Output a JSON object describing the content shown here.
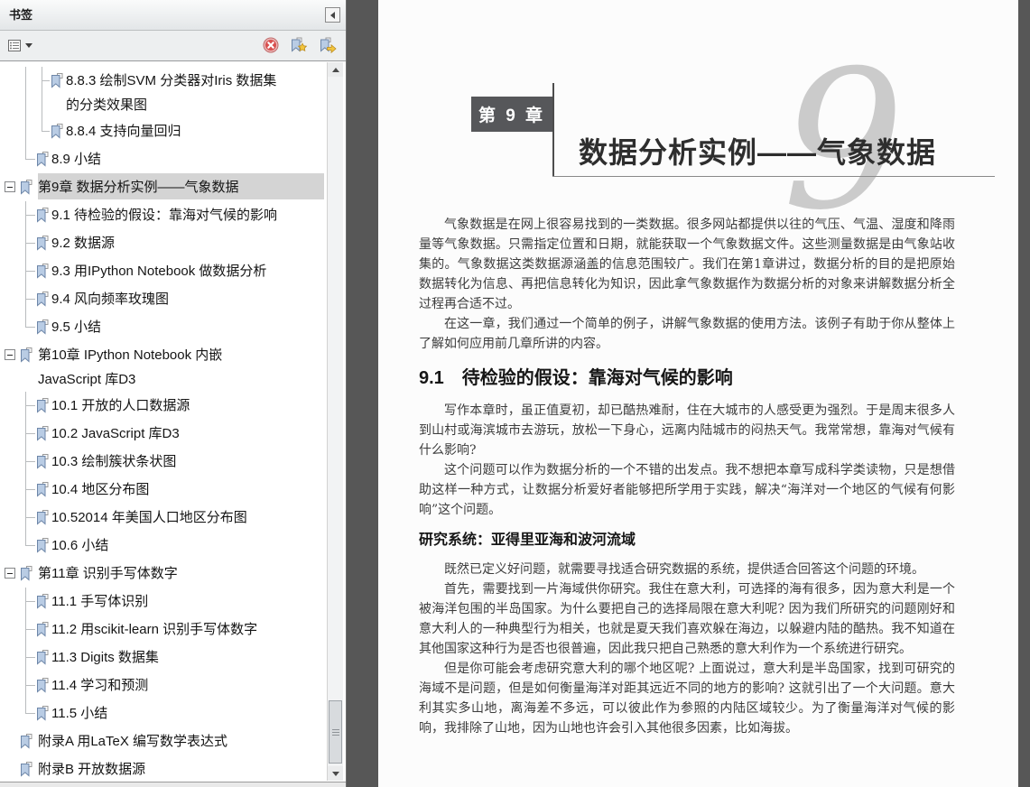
{
  "panel": {
    "title": "书签",
    "collapse_icon": "collapse-panel-left-arrow",
    "toolbar": {
      "icons": [
        "bookmark-options-list",
        "delete-bookmark",
        "new-bookmark",
        "locate-current-bookmark"
      ]
    },
    "scrollbar": {
      "thumb_position": "near-bottom"
    },
    "bookmarks": [
      {
        "label": "8.8.3 绘制SVM 分类器对Iris 数据集\n的分类效果图",
        "level": 2,
        "g1": "pass",
        "g2": "pass",
        "stub": 2
      },
      {
        "label": "8.8.4 支持向量回归",
        "level": 2,
        "g1": "pass",
        "g2": "end",
        "stub": 2
      },
      {
        "label": "8.9 小结",
        "level": 1,
        "g1": "end",
        "stub": 1
      },
      {
        "label": "第9章 数据分析实例——气象数据",
        "level": 0,
        "expander": true,
        "selected": true
      },
      {
        "label": "9.1 待检验的假设：靠海对气候的影响",
        "level": 1,
        "g1": "pass",
        "stub": 1
      },
      {
        "label": "9.2 数据源",
        "level": 1,
        "g1": "pass",
        "stub": 1
      },
      {
        "label": "9.3 用IPython Notebook 做数据分析",
        "level": 1,
        "g1": "pass",
        "stub": 1
      },
      {
        "label": "9.4 风向频率玫瑰图",
        "level": 1,
        "g1": "pass",
        "stub": 1
      },
      {
        "label": "9.5 小结",
        "level": 1,
        "g1": "end",
        "stub": 1
      },
      {
        "label": "第10章 IPython Notebook 内嵌\nJavaScript 库D3",
        "level": 0,
        "expander": true
      },
      {
        "label": "10.1 开放的人口数据源",
        "level": 1,
        "g1": "pass",
        "stub": 1
      },
      {
        "label": "10.2 JavaScript 库D3",
        "level": 1,
        "g1": "pass",
        "stub": 1
      },
      {
        "label": "10.3 绘制簇状条状图",
        "level": 1,
        "g1": "pass",
        "stub": 1
      },
      {
        "label": "10.4 地区分布图",
        "level": 1,
        "g1": "pass",
        "stub": 1
      },
      {
        "label": "10.52014 年美国人口地区分布图",
        "level": 1,
        "g1": "pass",
        "stub": 1
      },
      {
        "label": "10.6 小结",
        "level": 1,
        "g1": "end",
        "stub": 1
      },
      {
        "label": "第11章 识别手写体数字",
        "level": 0,
        "expander": true
      },
      {
        "label": "11.1 手写体识别",
        "level": 1,
        "g1": "pass",
        "stub": 1
      },
      {
        "label": "11.2 用scikit-learn 识别手写体数字",
        "level": 1,
        "g1": "pass",
        "stub": 1
      },
      {
        "label": "11.3 Digits 数据集",
        "level": 1,
        "g1": "pass",
        "stub": 1
      },
      {
        "label": "11.4 学习和预测",
        "level": 1,
        "g1": "pass",
        "stub": 1
      },
      {
        "label": "11.5 小结",
        "level": 1,
        "g1": "end",
        "stub": 1
      },
      {
        "label": "附录A 用LaTeX 编写数学表达式",
        "level": 0
      },
      {
        "label": "附录B 开放数据源",
        "level": 0
      }
    ]
  },
  "page": {
    "chapter_badge": "第 9 章",
    "chapter_title": "数据分析实例——气象数据",
    "watermark_digit": "9",
    "blocks": [
      {
        "type": "p",
        "text": "气象数据是在网上很容易找到的一类数据。很多网站都提供以往的气压、气温、湿度和降雨量等气象数据。只需指定位置和日期，就能获取一个气象数据文件。这些测量数据是由气象站收集的。气象数据这类数据源涵盖的信息范围较广。我们在第1章讲过，数据分析的目的是把原始数据转化为信息、再把信息转化为知识，因此拿气象数据作为数据分析的对象来讲解数据分析全过程再合适不过。"
      },
      {
        "type": "p",
        "text": "在这一章，我们通过一个简单的例子，讲解气象数据的使用方法。该例子有助于你从整体上了解如何应用前几章所讲的内容。"
      },
      {
        "type": "h1",
        "text": "9.1　待检验的假设：靠海对气候的影响"
      },
      {
        "type": "p",
        "text": "写作本章时，虽正值夏初，却已酷热难耐，住在大城市的人感受更为强烈。于是周末很多人到山村或海滨城市去游玩，放松一下身心，远离内陆城市的闷热天气。我常常想，靠海对气候有什么影响?"
      },
      {
        "type": "p",
        "text": "这个问题可以作为数据分析的一个不错的出发点。我不想把本章写成科学类读物，只是想借助这样一种方式，让数据分析爱好者能够把所学用于实践，解决“海洋对一个地区的气候有何影响”这个问题。"
      },
      {
        "type": "h2",
        "text": "研究系统：亚得里亚海和波河流域"
      },
      {
        "type": "p",
        "text": "既然已定义好问题，就需要寻找适合研究数据的系统，提供适合回答这个问题的环境。"
      },
      {
        "type": "p",
        "text": "首先，需要找到一片海域供你研究。我住在意大利，可选择的海有很多，因为意大利是一个被海洋包围的半岛国家。为什么要把自己的选择局限在意大利呢? 因为我们所研究的问题刚好和意大利人的一种典型行为相关，也就是夏天我们喜欢躲在海边，以躲避内陆的酷热。我不知道在其他国家这种行为是否也很普遍，因此我只把自己熟悉的意大利作为一个系统进行研究。"
      },
      {
        "type": "p",
        "text": "但是你可能会考虑研究意大利的哪个地区呢? 上面说过，意大利是半岛国家，找到可研究的海域不是问题，但是如何衡量海洋对距其远近不同的地方的影响? 这就引出了一个大问题。意大利其实多山地，离海差不多远，可以彼此作为参照的内陆区域较少。为了衡量海洋对气候的影响，我排除了山地，因为山地也许会引入其他很多因素，比如海拔。"
      }
    ]
  },
  "colors": {
    "selection_highlight": "#d4d4d4",
    "chapter_badge_bg": "#56575a",
    "watermark_gray": "#cbcbcb",
    "viewer_background": "#575757",
    "bookmark_icon_blue": "#b9cce4",
    "delete_icon_red": "#d85050",
    "accent_yellow": "#f3c53d"
  }
}
